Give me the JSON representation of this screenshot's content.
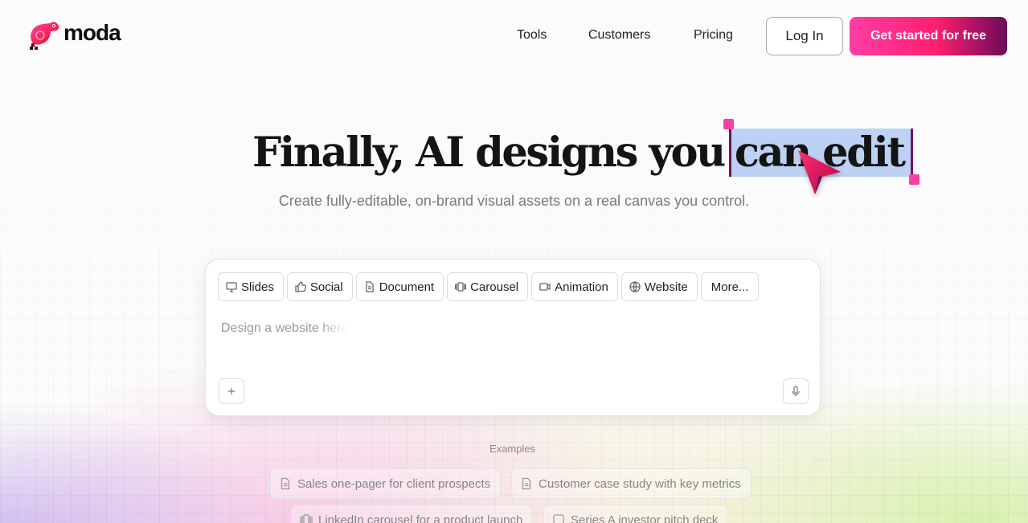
{
  "brand": {
    "name": "moda"
  },
  "nav": {
    "links": [
      "Tools",
      "Customers",
      "Pricing"
    ],
    "login": "Log In",
    "cta": "Get started for free"
  },
  "hero": {
    "title_before": "Finally, AI designs you",
    "title_highlight": "can edit",
    "subtitle": "Create fully-editable, on-brand visual assets on a real canvas you control."
  },
  "prompt": {
    "chips": [
      {
        "label": "Slides",
        "icon": "monitor-icon"
      },
      {
        "label": "Social",
        "icon": "thumbs-up-icon"
      },
      {
        "label": "Document",
        "icon": "document-icon"
      },
      {
        "label": "Carousel",
        "icon": "carousel-icon"
      },
      {
        "label": "Animation",
        "icon": "video-icon"
      },
      {
        "label": "Website",
        "icon": "globe-icon"
      },
      {
        "label": "More...",
        "icon": ""
      }
    ],
    "placeholder": "Design a website here",
    "add_icon": "plus-icon",
    "mic_icon": "microphone-icon"
  },
  "examples": {
    "label": "Examples",
    "items": [
      {
        "label": "Sales one-pager for client prospects",
        "icon": "document-icon"
      },
      {
        "label": "Customer case study with key metrics",
        "icon": "document-icon"
      },
      {
        "label": "LinkedIn carousel for a product launch",
        "icon": "carousel-icon"
      },
      {
        "label": "Series A investor pitch deck",
        "icon": "slides-icon"
      }
    ]
  },
  "colors": {
    "cta_start": "#ff3ea5",
    "cta_end": "#6a0b5a",
    "selection": "#bcd1f3",
    "handle": "#ff3ea5",
    "cursor": "#ff2d6f"
  }
}
